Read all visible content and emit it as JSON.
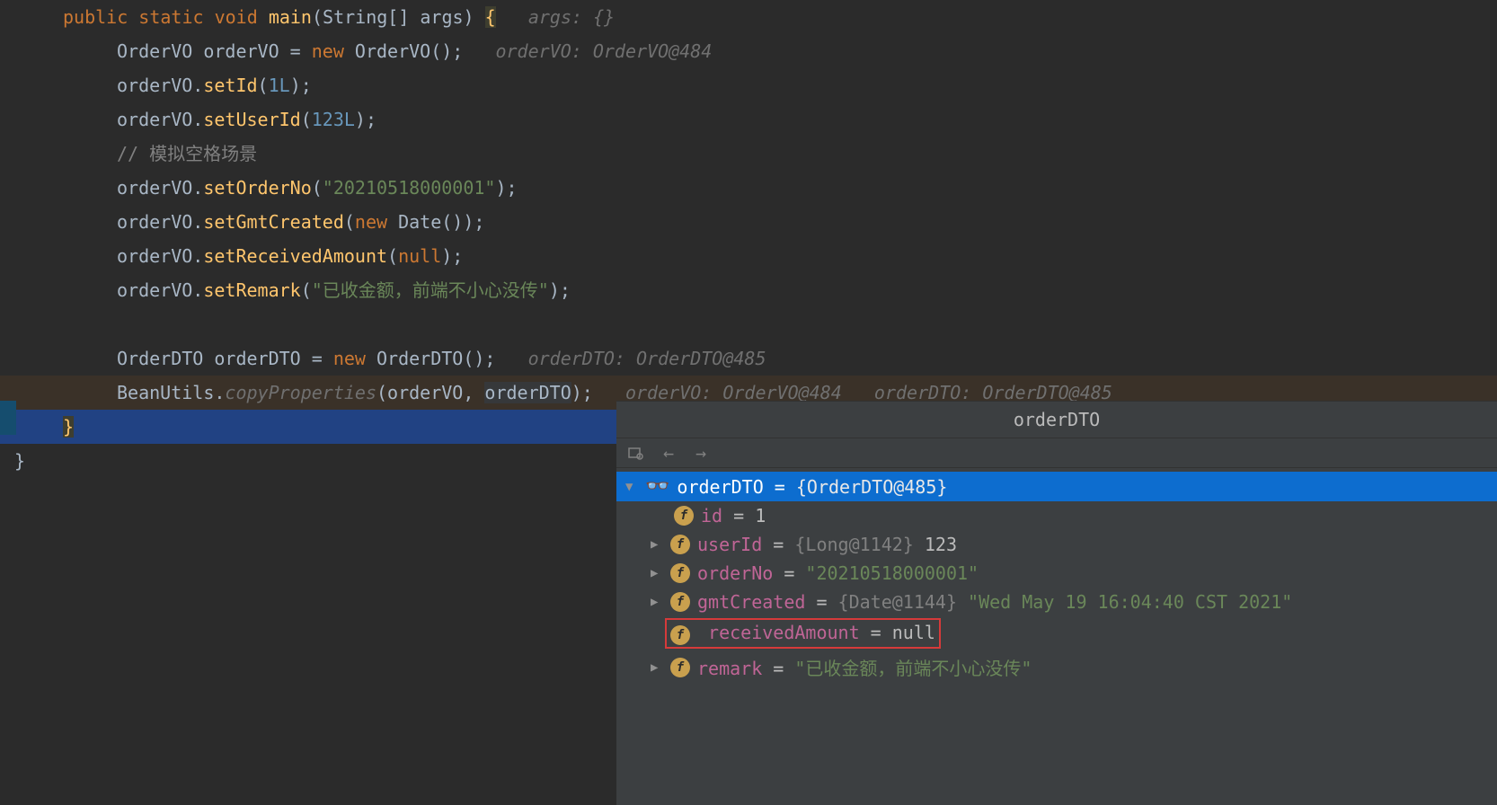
{
  "code": {
    "l1": {
      "kw1": "public",
      "kw2": "static",
      "kw3": "void",
      "m": "main",
      "sig": "(String[] args)",
      "brace": "{",
      "hint": "args: {}"
    },
    "l2": {
      "t": "OrderVO",
      "v": "orderVO",
      "eq": " = ",
      "kw": "new",
      "ctor": " OrderVO();",
      "hint": "orderVO: OrderVO@484"
    },
    "l3": {
      "v": "orderVO.",
      "m": "setId",
      "open": "(",
      "num": "1L",
      "close": ");"
    },
    "l4": {
      "v": "orderVO.",
      "m": "setUserId",
      "open": "(",
      "num": "123L",
      "close": ");"
    },
    "l5": {
      "c": "// 模拟空格场景"
    },
    "l6": {
      "v": "orderVO.",
      "m": "setOrderNo",
      "open": "(",
      "s": "\"20210518000001\"",
      "close": ");"
    },
    "l7": {
      "v": "orderVO.",
      "m": "setGmtCreated",
      "open": "(",
      "kw": "new",
      "d": " Date()",
      "close": ");"
    },
    "l8": {
      "v": "orderVO.",
      "m": "setReceivedAmount",
      "open": "(",
      "n": "null",
      "close": ");"
    },
    "l9": {
      "v": "orderVO.",
      "m": "setRemark",
      "open": "(",
      "s": "\"已收金额，前端不小心没传\"",
      "close": ");"
    },
    "l10": {
      "t": "OrderDTO",
      "v": "orderDTO",
      "eq": " = ",
      "kw": "new",
      "ctor": " OrderDTO();",
      "hint": "orderDTO: OrderDTO@485"
    },
    "l11": {
      "cls": "BeanUtils.",
      "m": "copyProperties",
      "open": "(orderVO, ",
      "arg2": "orderDTO",
      "close": ");",
      "hint1": "orderVO: OrderVO@484",
      "hint2": "orderDTO: OrderDTO@485"
    },
    "l12": {
      "brace": "}"
    },
    "l13": {
      "brace": "}"
    }
  },
  "debug": {
    "title": "orderDTO",
    "root": {
      "name": "orderDTO",
      "eq": " = ",
      "val": "{OrderDTO@485}"
    },
    "fields": [
      {
        "name": "id",
        "eq": " = ",
        "val": "1",
        "expandable": false,
        "type": "plain"
      },
      {
        "name": "userId",
        "eq": " = ",
        "obj": "{Long@1142} ",
        "val": "123",
        "expandable": true,
        "type": "long"
      },
      {
        "name": "orderNo",
        "eq": " = ",
        "val": "\"20210518000001\"",
        "expandable": true,
        "type": "str"
      },
      {
        "name": "gmtCreated",
        "eq": " = ",
        "obj": "{Date@1144} ",
        "val": "\"Wed May 19 16:04:40 CST 2021\"",
        "expandable": true,
        "type": "date"
      },
      {
        "name": "receivedAmount",
        "eq": " = ",
        "val": "null",
        "expandable": false,
        "type": "plain",
        "highlight": true
      },
      {
        "name": "remark",
        "eq": " = ",
        "val": "\"已收金额，前端不小心没传\"",
        "expandable": true,
        "type": "str"
      }
    ]
  }
}
